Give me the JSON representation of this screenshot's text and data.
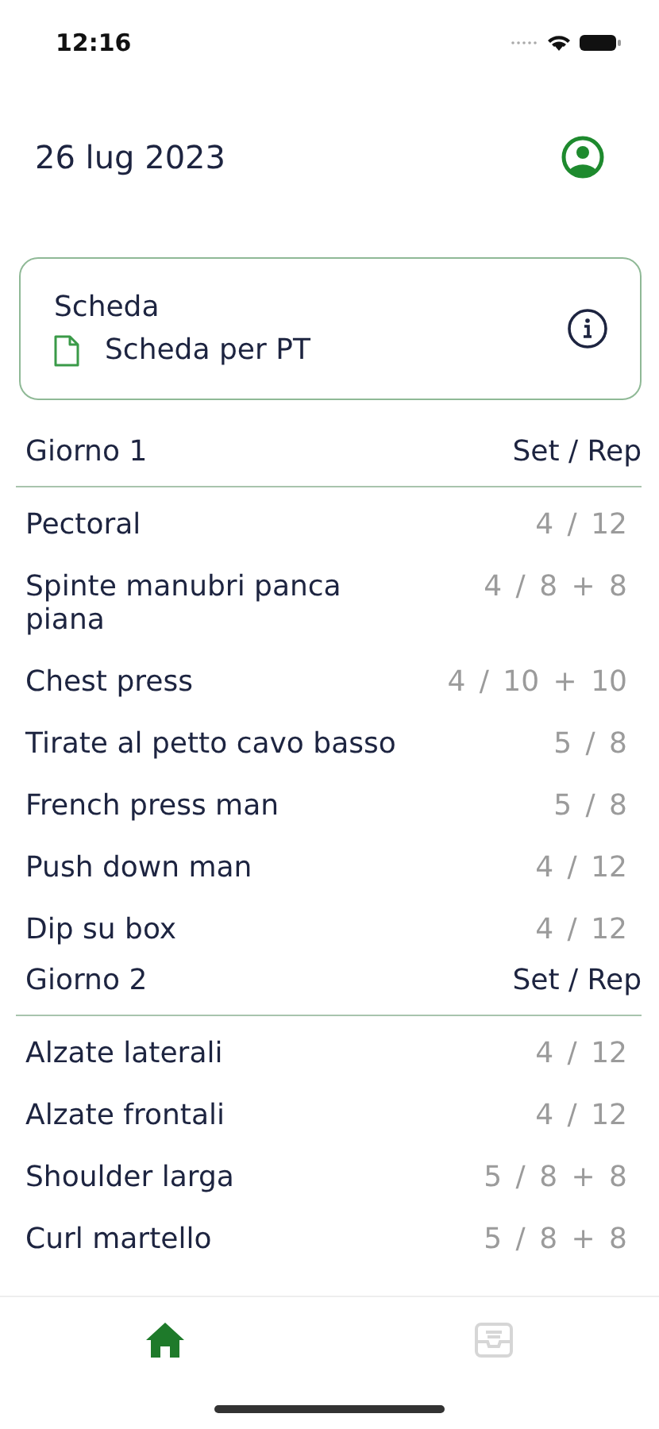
{
  "status_bar": {
    "time": "12:16"
  },
  "header": {
    "date": "26 lug 2023"
  },
  "card": {
    "title": "Scheda",
    "plan": "Scheda per PT"
  },
  "days": [
    {
      "title": "Giorno 1",
      "column": "Set / Rep",
      "exercises": [
        {
          "name": "Pectoral",
          "sets": "4 / 12"
        },
        {
          "name": "Spinte manubri panca piana",
          "sets": "4 / 8 + 8"
        },
        {
          "name": "Chest press",
          "sets": "4 / 10 + 10"
        },
        {
          "name": "Tirate al petto cavo basso",
          "sets": "5 / 8"
        },
        {
          "name": "French press man",
          "sets": "5 / 8"
        },
        {
          "name": "Push down man",
          "sets": "4 / 12"
        },
        {
          "name": "Dip su box",
          "sets": "4 / 12"
        }
      ]
    },
    {
      "title": "Giorno 2",
      "column": "Set / Rep",
      "exercises": [
        {
          "name": "Alzate laterali",
          "sets": "4 / 12"
        },
        {
          "name": "Alzate frontali",
          "sets": "4 / 12"
        },
        {
          "name": "Shoulder larga",
          "sets": "5 / 8 + 8"
        },
        {
          "name": "Curl martello",
          "sets": "5 / 8 + 8"
        }
      ]
    }
  ],
  "tab_bar": [
    {
      "kind": "home",
      "selected": true
    },
    {
      "kind": "inbox",
      "selected": false
    }
  ]
}
